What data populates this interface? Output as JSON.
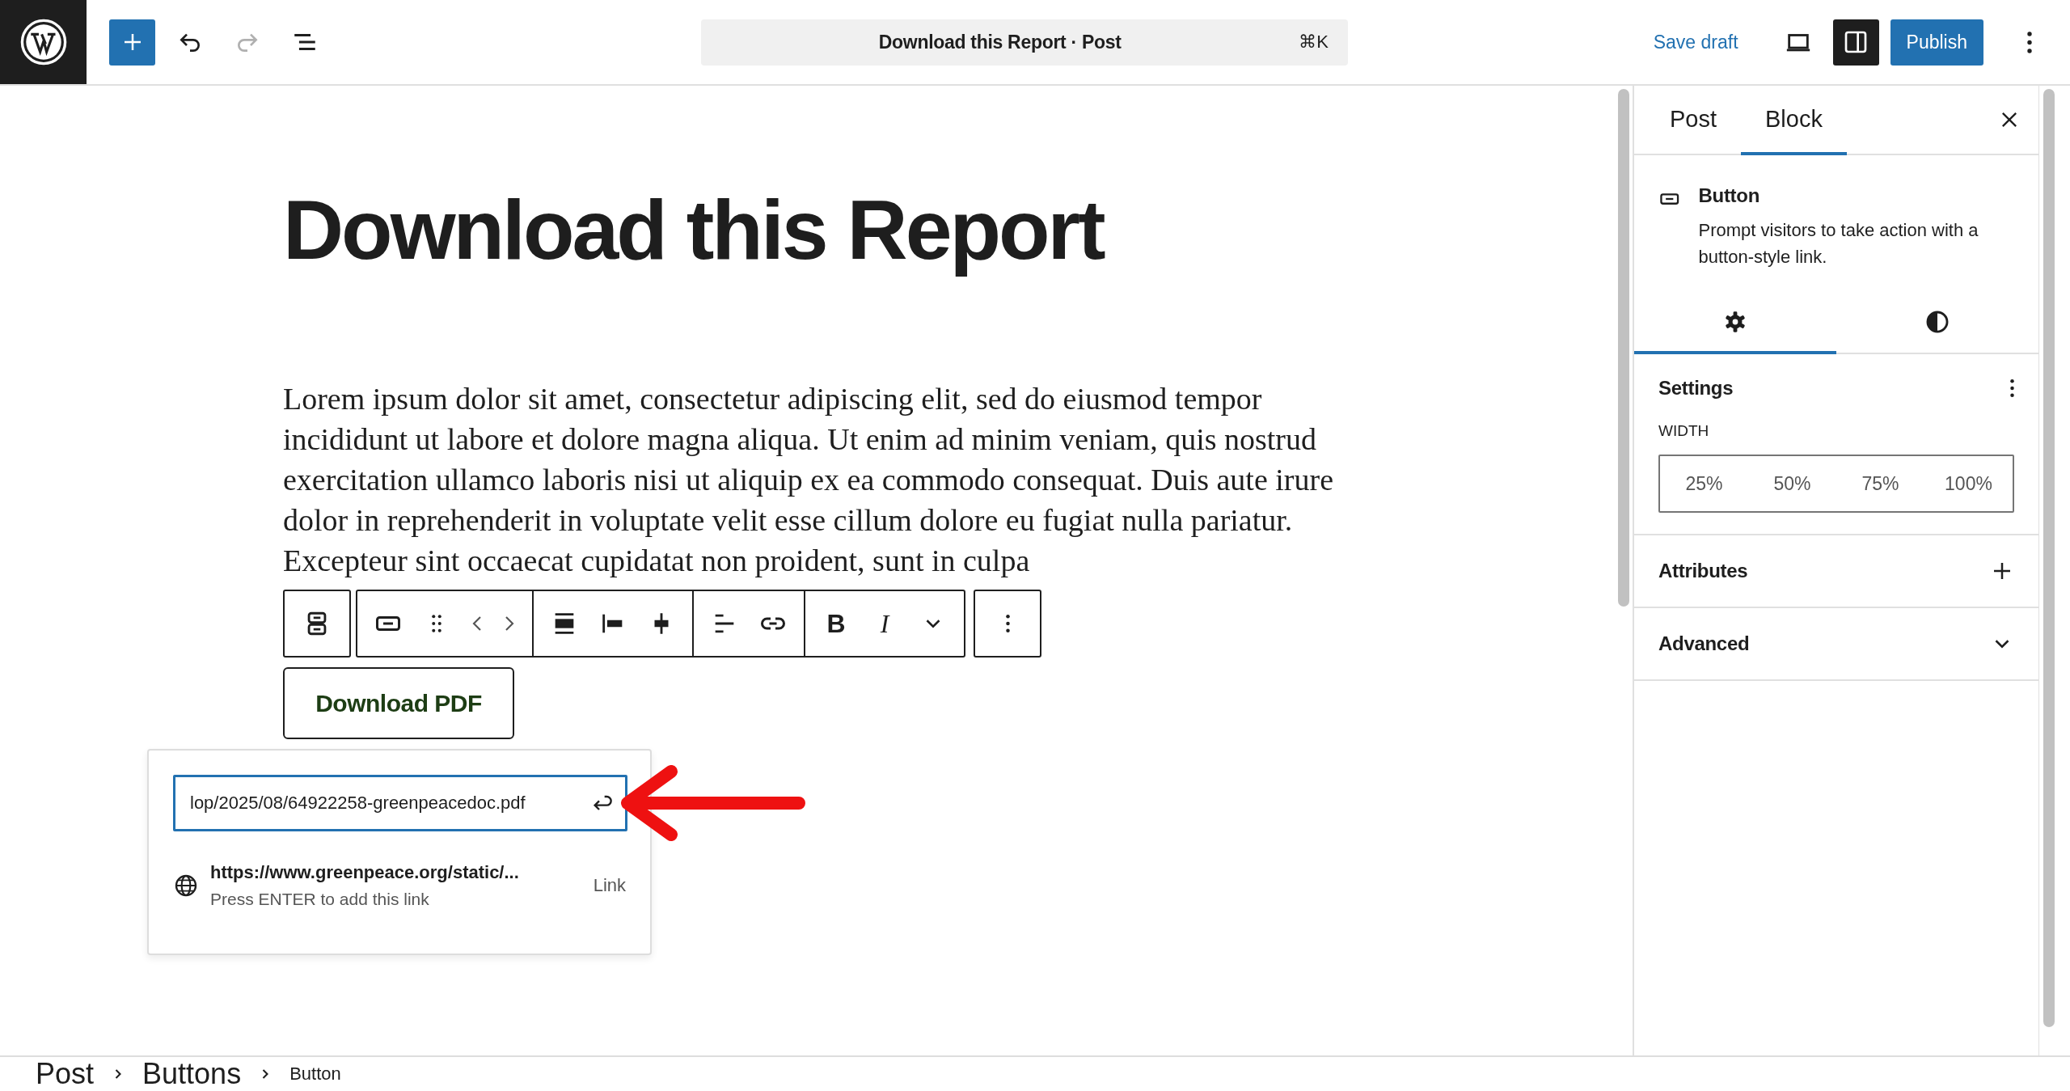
{
  "topbar": {
    "undo_enabled": true,
    "redo_enabled": false,
    "document_title": "Download this Report · Post",
    "shortcut": "⌘K",
    "save_draft": "Save draft",
    "sidebar_toggle_on": true,
    "publish": "Publish"
  },
  "editor": {
    "title": "Download this Report",
    "paragraph": "Lorem ipsum dolor sit amet, consectetur adipiscing elit, sed do eiusmod tempor incididunt ut labore et dolore magna aliqua. Ut enim ad minim veniam, quis nostrud exercitation ullamco laboris nisi ut aliquip ex ea commodo consequat. Duis aute irure dolor in reprehenderit in voluptate velit esse cillum dolore eu fugiat nulla pariatur. Excepteur sint occaecat cupidatat non proident, sunt in culpa",
    "block_toolbar": {
      "bold": "B",
      "italic": "I"
    },
    "button_label": "Download PDF",
    "link_popup": {
      "value": "lop/2025/08/64922258-greenpeacedoc.pdf",
      "suggestion_url": "https://www.greenpeace.org/static/...",
      "suggestion_hint": "Press ENTER to add this link",
      "suggestion_type": "Link"
    }
  },
  "sidebar": {
    "tabs": [
      {
        "label": "Post",
        "selected": false
      },
      {
        "label": "Block",
        "selected": true
      }
    ],
    "block": {
      "name": "Button",
      "description": "Prompt visitors to take action with a button-style link."
    },
    "style_tabs": [
      {
        "kind": "settings",
        "selected": true
      },
      {
        "kind": "styles",
        "selected": false
      }
    ],
    "settings": {
      "title": "Settings",
      "width_label": "WIDTH",
      "width_options": [
        {
          "label": "25%",
          "selected": false
        },
        {
          "label": "50%",
          "selected": false
        },
        {
          "label": "75%",
          "selected": false
        },
        {
          "label": "100%",
          "selected": false
        }
      ]
    },
    "panels": [
      {
        "title": "Attributes",
        "kind": "add"
      },
      {
        "title": "Advanced",
        "kind": "expand"
      }
    ]
  },
  "breadcrumb": [
    {
      "label": "Post",
      "selected": false
    },
    {
      "label": "Buttons",
      "selected": false
    },
    {
      "label": "Button",
      "selected": true
    }
  ]
}
